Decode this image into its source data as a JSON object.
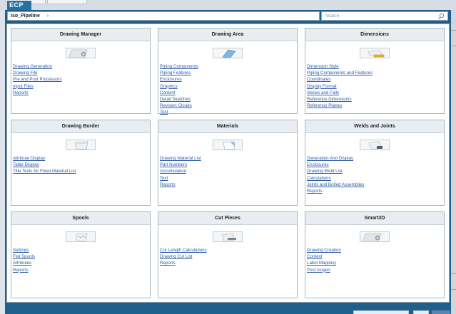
{
  "app": {
    "logo_text": "ECP"
  },
  "breadcrumb": {
    "root": "Iso_Pipeline",
    "separator": "›"
  },
  "search": {
    "placeholder": "Search"
  },
  "cards": [
    {
      "title": "Drawing Manager",
      "icon": "drawing-manager-gear-icon",
      "links": [
        "Drawing Generation",
        "Drawing File",
        "Pre and Post Processors",
        "Input Files",
        "Reports"
      ]
    },
    {
      "title": "Drawing Area",
      "icon": "drawing-area-icon",
      "links": [
        "Piping Components",
        "Piping Features",
        "Enclosures",
        "Graphics",
        "Content",
        "Detail Sketches",
        "Revision Clouds",
        "Text"
      ]
    },
    {
      "title": "Dimensions",
      "icon": "dimensions-ruler-icon",
      "links": [
        "Dimension Style",
        "Piping Components and Features",
        "Coordinates",
        "Display Format",
        "Skews and Falls",
        "Reference Dimensions",
        "Reference Planes"
      ]
    },
    {
      "title": "Drawing Border",
      "icon": "drawing-border-icon",
      "links": [
        "Attribute Display",
        "Table Display",
        "Title Texts for Fixed Material List"
      ]
    },
    {
      "title": "Materials",
      "icon": "materials-icon",
      "links": [
        "Drawing Material List",
        "Part Numbers",
        "Accumulation",
        "Text",
        "Reports"
      ]
    },
    {
      "title": "Welds and Joints",
      "icon": "welds-joints-icon",
      "links": [
        "Generation And Display",
        "Enclosures",
        "Drawing Weld List",
        "Calculations",
        "Joints and Bolted Assemblies",
        "Reports"
      ]
    },
    {
      "title": "Spools",
      "icon": "spools-icon",
      "links": [
        "Settings",
        "Flat Spools",
        "Attributes",
        "Reports"
      ]
    },
    {
      "title": "Cut Pieces",
      "icon": "cut-pieces-icon",
      "links": [
        "Cut Length Calculations",
        "Drawing Cut List",
        "Reports"
      ]
    },
    {
      "title": "Smart3D",
      "icon": "smart3d-gear-icon",
      "links": [
        "Drawing Creation",
        "Content",
        "Label Mapping",
        "Post Isogen"
      ]
    }
  ],
  "colors": {
    "link": "#2d5ca8",
    "frame": "#1f5f8c",
    "header_bg": "#e9edf1"
  }
}
